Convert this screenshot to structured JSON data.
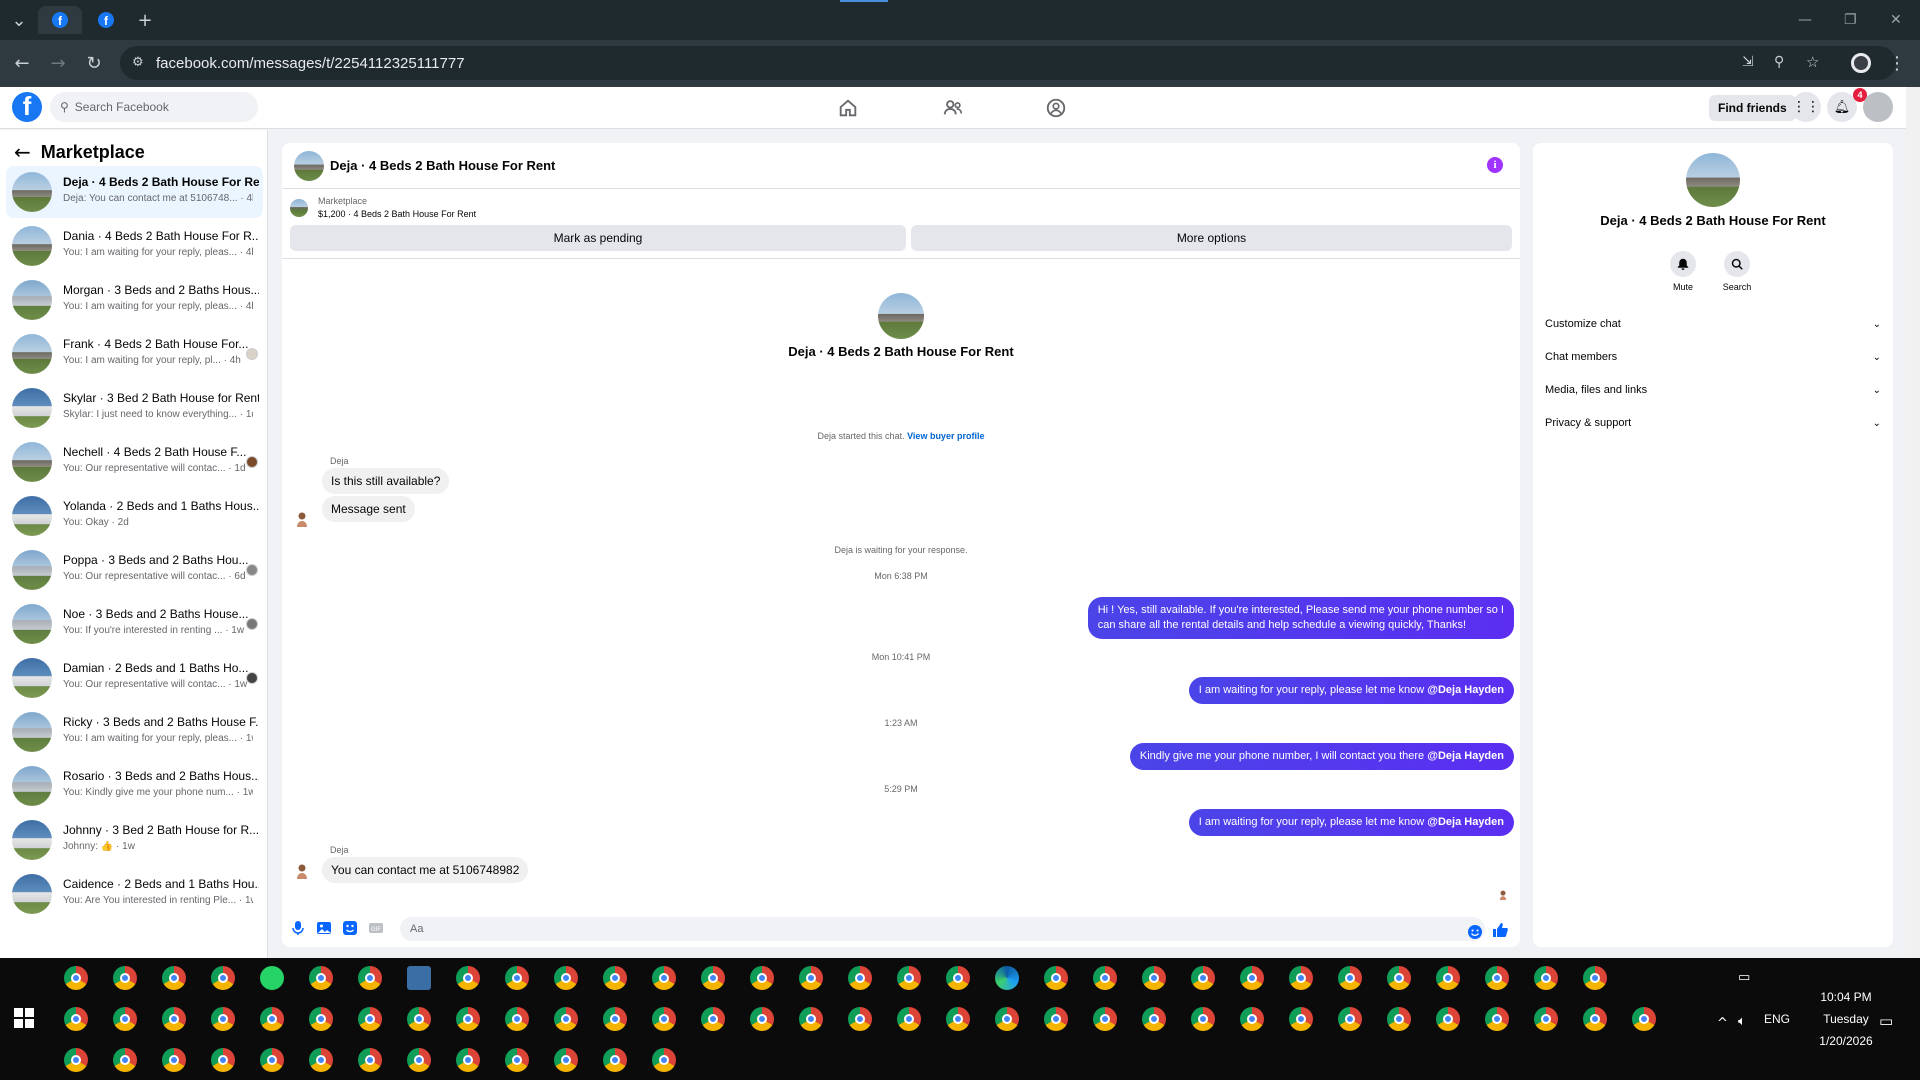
{
  "browser": {
    "url": "facebook.com/messages/t/2254112325111777",
    "new_tab": "+"
  },
  "fb": {
    "logo": "f",
    "search_placeholder": "Search Facebook",
    "find_friends": "Find friends",
    "notif_count": "4"
  },
  "sidebar": {
    "title": "Marketplace",
    "conversations": [
      {
        "name": "Deja · 4 Beds 2 Bath House For Rent",
        "preview": "Deja: You can contact me at 5106748... · 4h",
        "active": true
      },
      {
        "name": "Dania · 4 Beds 2 Bath House For R...",
        "preview": "You: I am waiting for your reply, pleas... · 4h"
      },
      {
        "name": "Morgan · 3 Beds and 2 Baths Hous...",
        "preview": "You: I am waiting for your reply, pleas... · 4h"
      },
      {
        "name": "Frank · 4 Beds 2 Bath House For...",
        "preview": "You: I am waiting for your reply, pl... · 4h"
      },
      {
        "name": "Skylar · 3 Bed 2 Bath House for Rent",
        "preview": "Skylar: I just need to know everything... · 1d"
      },
      {
        "name": "Nechell · 4 Beds 2 Bath House F...",
        "preview": "You: Our representative will contac... · 1d"
      },
      {
        "name": "Yolanda · 2 Beds and 1 Baths Hous...",
        "preview": "You: Okay · 2d"
      },
      {
        "name": "Poppa · 3 Beds and 2 Baths Hou...",
        "preview": "You: Our representative will contac... · 6d"
      },
      {
        "name": "Noe · 3 Beds and 2 Baths House...",
        "preview": "You: If you're interested in renting ... · 1w"
      },
      {
        "name": "Damian · 2 Beds and 1 Baths Ho...",
        "preview": "You: Our representative will contac... · 1w"
      },
      {
        "name": "Ricky · 3 Beds and 2 Baths House F...",
        "preview": "You: I am waiting for your reply, pleas... · 1w"
      },
      {
        "name": "Rosario · 3 Beds and 2 Baths Hous...",
        "preview": "You: Kindly give me your phone num... · 1w"
      },
      {
        "name": "Johnny · 3 Bed 2 Bath House for R...",
        "preview": "Johnny: 👍 · 1w"
      },
      {
        "name": "Caidence · 2 Beds and 1 Baths Hou...",
        "preview": "You: Are You interested in renting Ple... · 1w"
      }
    ]
  },
  "chat": {
    "title": "Deja · 4 Beds 2 Bath House For Rent",
    "listing_label": "Marketplace",
    "listing_info": "$1,200 · 4 Beds 2 Bath House For Rent",
    "mark_pending": "Mark as pending",
    "more_options": "More options",
    "profile_name": "Deja · 4 Beds 2 Bath House For Rent",
    "started_text": "Deja started this chat.",
    "view_profile": "View buyer profile",
    "sender1": "Deja",
    "msg1": "Is this still available?",
    "msg2": "Message sent",
    "waiting": "Deja is waiting for your response.",
    "time1": "Mon 6:38 PM",
    "out1_line1": "Hi ! Yes, still available. If you're interested, Please send me your phone number so I",
    "out1_line2": "can share all the rental details and help schedule a viewing quickly, Thanks!",
    "time2": "Mon 10:41 PM",
    "out2_text": "I am waiting for your reply, please let me know ",
    "out2_mention": "@Deja Hayden",
    "time3": "1:23 AM",
    "out3_text": "Kindly give me your phone number, I will contact you there ",
    "out3_mention": "@Deja Hayden",
    "time4": "5:29 PM",
    "out4_text": "I am waiting for your reply, please let me know ",
    "out4_mention": "@Deja Hayden",
    "sender2": "Deja",
    "msg3": "You can contact me at 5106748982",
    "input_placeholder": "Aa"
  },
  "rpanel": {
    "name": "Deja · 4 Beds 2 Bath House For Rent",
    "mute": "Mute",
    "search": "Search",
    "items": [
      "Customize chat",
      "Chat members",
      "Media, files and links",
      "Privacy & support"
    ]
  },
  "taskbar": {
    "time": "10:04 PM",
    "day": "Tuesday",
    "date": "1/20/2026",
    "lang": "ENG"
  },
  "colors": {
    "fb_blue": "#1877f2",
    "outgoing": "#4b44e8",
    "badge": "#e41e3f"
  }
}
